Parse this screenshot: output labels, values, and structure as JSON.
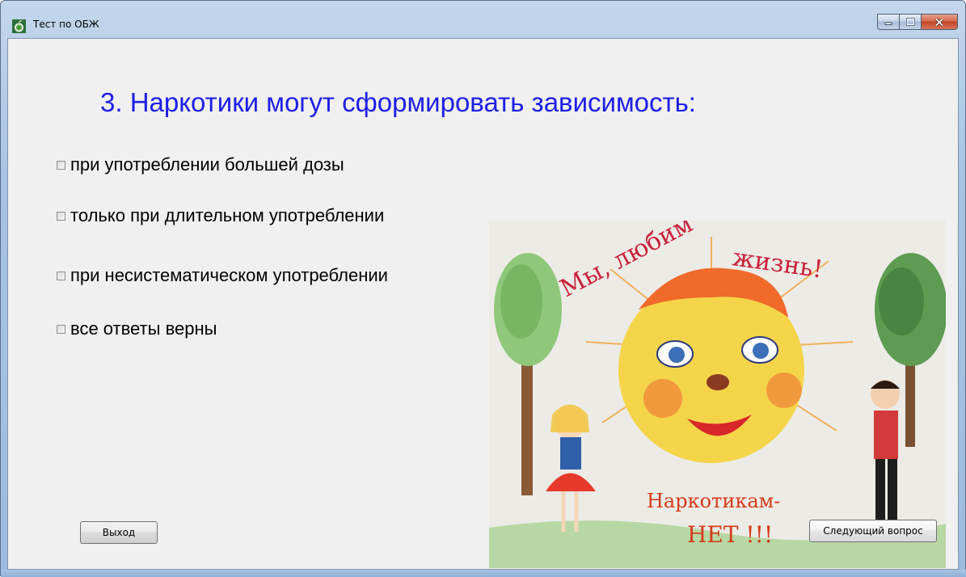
{
  "window": {
    "title": "Тест по ОБЖ",
    "icon": "apple-icon",
    "controls": [
      "minimize-icon",
      "maximize-icon",
      "close-icon"
    ]
  },
  "question": {
    "text": "3. Наркотики могут сформировать зависимость:"
  },
  "options": [
    {
      "label": "при употреблении большей дозы",
      "checked": false
    },
    {
      "label": "только при длительном употреблении",
      "checked": false
    },
    {
      "label": "при несистематическом употреблении",
      "checked": false
    },
    {
      "label": "все ответы верны",
      "checked": false
    }
  ],
  "buttons": {
    "exit_label": "Выход",
    "next_label": "Следующий вопрос"
  },
  "picture": {
    "heading": "Мы, любим жизнь!",
    "slogan_line1": "Наркотикам-",
    "slogan_line2": "НЕТ !!!"
  },
  "colors": {
    "question": "#1e1ee6",
    "client_background": "#f0f0f0",
    "titlebar": "#b4cde8"
  }
}
